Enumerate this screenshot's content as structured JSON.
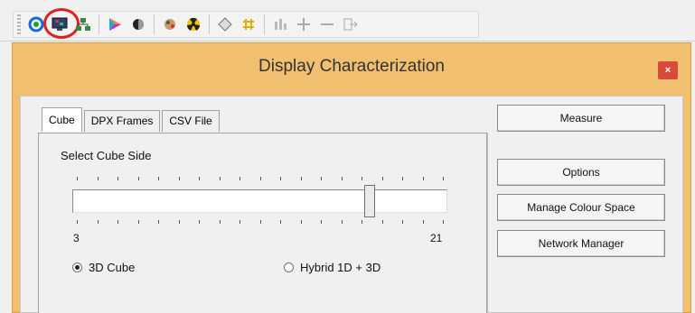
{
  "toolbar": {
    "icons": [
      "target-icon",
      "display-monitor-icon",
      "hierarchy-icon",
      "color-triangle-icon",
      "contrast-icon",
      "gamut-icon",
      "radiation-icon",
      "diamond-icon",
      "grid-icon",
      "bar-chart-icon",
      "plus-icon",
      "minus-icon",
      "export-icon"
    ],
    "highlighted": "display-monitor-icon"
  },
  "dialog": {
    "title": "Display Characterization",
    "close_label": "×",
    "accent_color": "#f0c070"
  },
  "tabs": [
    {
      "label": "Cube",
      "active": true
    },
    {
      "label": "DPX Frames",
      "active": false
    },
    {
      "label": "CSV File",
      "active": false
    }
  ],
  "cube": {
    "select_label": "Select Cube Side",
    "slider_min": "3",
    "slider_max": "21",
    "slider_value": 0.8,
    "radio_3d": "3D Cube",
    "radio_hybrid": "Hybrid 1D + 3D",
    "selected_mode": "3D Cube"
  },
  "buttons": {
    "measure": "Measure",
    "options": "Options",
    "manage_colour_space": "Manage Colour Space",
    "network_manager": "Network Manager"
  }
}
